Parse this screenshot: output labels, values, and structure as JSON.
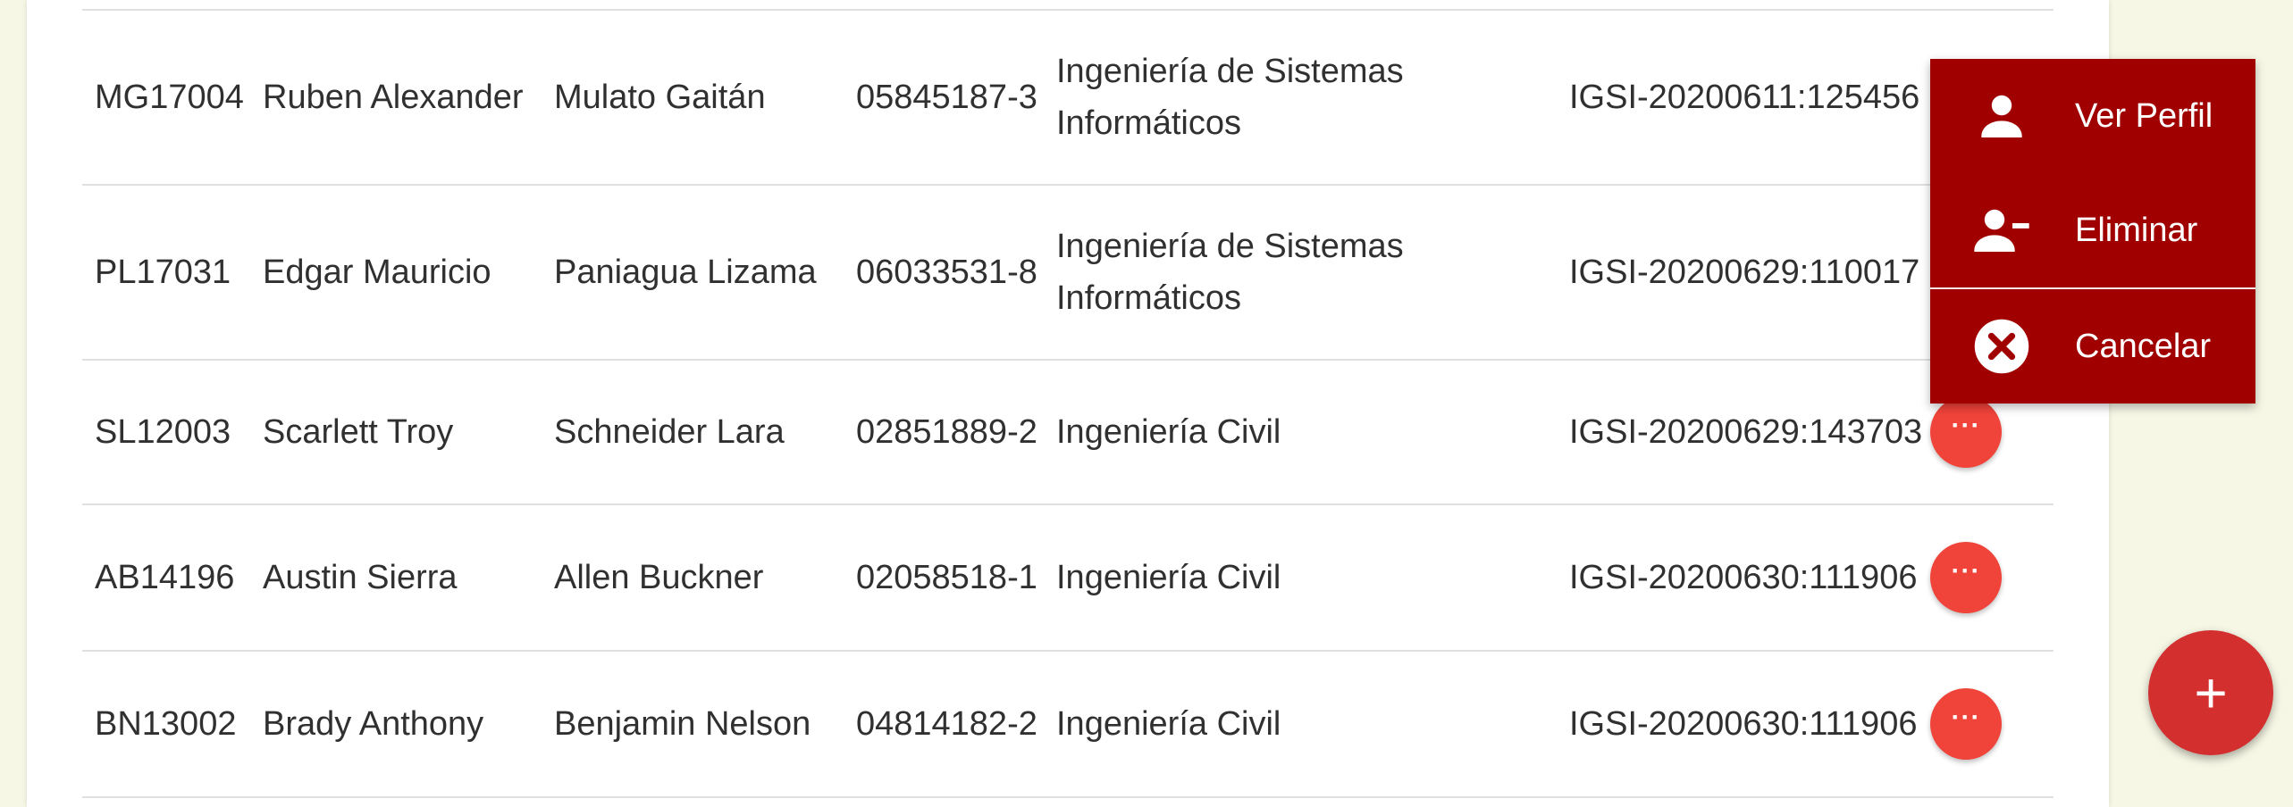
{
  "table": {
    "rows": [
      {
        "code": "MG17004",
        "names": "Ruben Alexander",
        "lastnames": "Mulato Gaitán",
        "dui": "05845187-3",
        "career": "Ingeniería de Sistemas Informáticos",
        "ticket": "IGSI-20200611:125456"
      },
      {
        "code": "PL17031",
        "names": "Edgar Mauricio",
        "lastnames": "Paniagua Lizama",
        "dui": "06033531-8",
        "career": "Ingeniería de Sistemas Informáticos",
        "ticket": "IGSI-20200629:110017"
      },
      {
        "code": "SL12003",
        "names": "Scarlett Troy",
        "lastnames": "Schneider Lara",
        "dui": "02851889-2",
        "career": "Ingeniería Civil",
        "ticket": "IGSI-20200629:143703"
      },
      {
        "code": "AB14196",
        "names": "Austin Sierra",
        "lastnames": "Allen Buckner",
        "dui": "02058518-1",
        "career": "Ingeniería Civil",
        "ticket": "IGSI-20200630:111906"
      },
      {
        "code": "BN13002",
        "names": "Brady Anthony",
        "lastnames": "Benjamin Nelson",
        "dui": "04814182-2",
        "career": "Ingeniería Civil",
        "ticket": "IGSI-20200630:111906"
      }
    ],
    "row_action_icon": "more-horiz-icon"
  },
  "context_menu": {
    "items": [
      {
        "label": "Ver Perfil",
        "icon": "person-icon"
      },
      {
        "label": "Eliminar",
        "icon": "person-remove-icon"
      },
      {
        "label": "Cancelar",
        "icon": "cancel-circle-icon"
      }
    ],
    "background": "#a00000"
  },
  "fab": {
    "label": "+",
    "icon": "add-icon",
    "color": "#d32f2f"
  },
  "colors": {
    "row_action": "#f0433a",
    "page_background": "#f7f7e6"
  }
}
